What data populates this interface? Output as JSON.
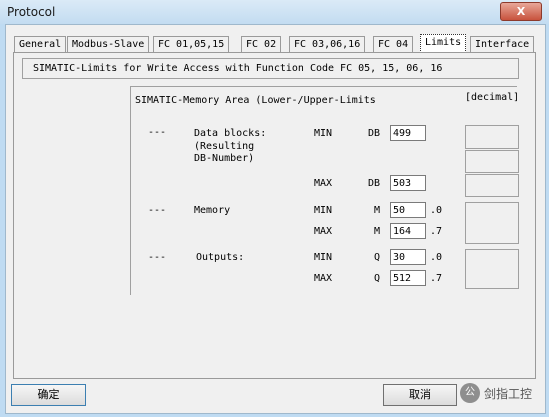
{
  "window": {
    "title": "Protocol",
    "close_glyph": "X"
  },
  "tabs": [
    {
      "label": "General"
    },
    {
      "label": "Modbus-Slave"
    },
    {
      "label": "FC 01,05,15"
    },
    {
      "label": "FC 02"
    },
    {
      "label": "FC 03,06,16"
    },
    {
      "label": "FC 04"
    },
    {
      "label": "Limits",
      "active": true
    },
    {
      "label": "Interface"
    }
  ],
  "limits": {
    "header": "SIMATIC-Limits for Write Access with Function Code  FC 05, 15,   06, 16",
    "memory_area": {
      "header": "SIMATIC-Memory Area  (Lower-/Upper-Limits",
      "unit": "[decimal]",
      "rows": {
        "data_blocks": {
          "dashes": "---",
          "label_lines": [
            "Data blocks:",
            "(Resulting",
            "DB-Number)"
          ],
          "min_label": "MIN",
          "min_type": "DB",
          "min_value": "499",
          "max_label": "MAX",
          "max_type": "DB",
          "max_value": "503"
        },
        "memory": {
          "dashes": "---",
          "label": "Memory",
          "min_label": "MIN",
          "min_type": "M",
          "min_value": "50",
          "min_bit": ".0",
          "max_label": "MAX",
          "max_type": "M",
          "max_value": "164",
          "max_bit": ".7"
        },
        "outputs": {
          "dashes": "---",
          "label": "Outputs:",
          "min_label": "MIN",
          "min_type": "Q",
          "min_value": "30",
          "min_bit": ".0",
          "max_label": "MAX",
          "max_type": "Q",
          "max_value": "512",
          "max_bit": ".7"
        }
      }
    }
  },
  "buttons": {
    "ok": "确定",
    "cancel": "取消"
  },
  "watermark": {
    "text": "剑指工控",
    "logo": "公"
  }
}
